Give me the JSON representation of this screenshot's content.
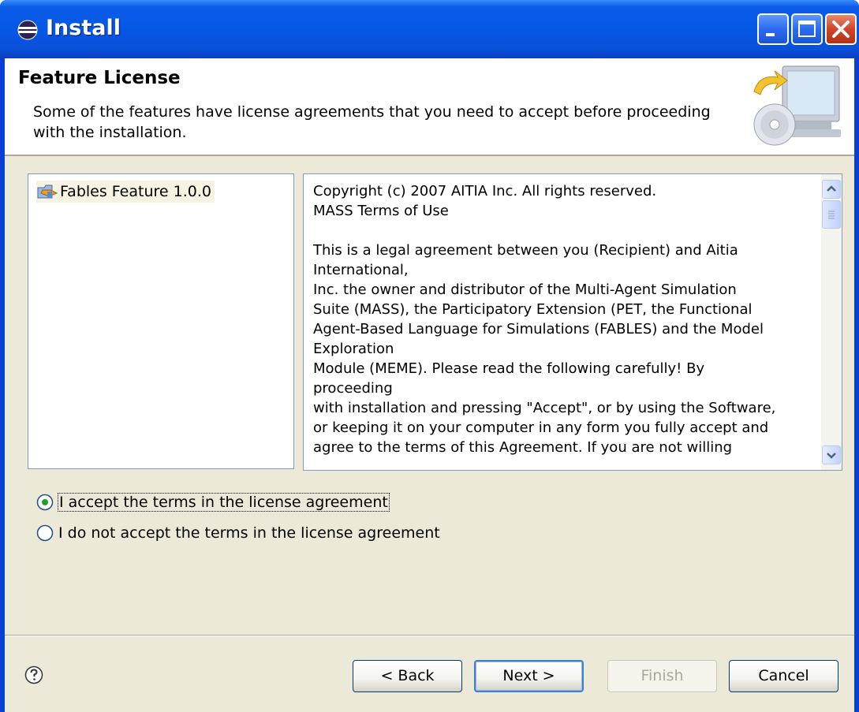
{
  "window": {
    "title": "Install"
  },
  "header": {
    "title": "Feature License",
    "description": "Some of the features have license agreements that you need to accept before proceeding with the installation."
  },
  "features": [
    {
      "label": "Fables Feature 1.0.0",
      "icon": "feature-folder-icon"
    }
  ],
  "license": {
    "lines": [
      "Copyright (c) 2007 AITIA Inc. All rights reserved.",
      "MASS Terms of Use",
      "",
      "This is a legal agreement between you (Recipient) and Aitia",
      "International,",
      "Inc. the owner and distributor of the Multi-Agent Simulation",
      "Suite (MASS), the Participatory Extension (PET, the Functional",
      "Agent-Based Language for Simulations (FABLES) and the Model",
      "Exploration",
      "Module (MEME). Please read the following carefully!  By",
      "proceeding",
      "with installation and pressing \"Accept\", or by using the Software,",
      "or keeping it on your computer in any form you fully accept and",
      "agree to the terms of this Agreement. If you are not willing"
    ]
  },
  "options": {
    "accept_label": "I accept the terms in the license agreement",
    "decline_label": "I do not accept the terms in the license agreement",
    "selected": "accept"
  },
  "buttons": {
    "back": "< Back",
    "next": "Next >",
    "finish": "Finish",
    "cancel": "Cancel"
  },
  "icons": {
    "title": "eclipse-icon",
    "help": "help-icon",
    "header": "install-wizard-icon"
  },
  "colors": {
    "title_bar": "#0657e6",
    "dialog_bg": "#ece9d8",
    "close_button": "#d1442a"
  }
}
